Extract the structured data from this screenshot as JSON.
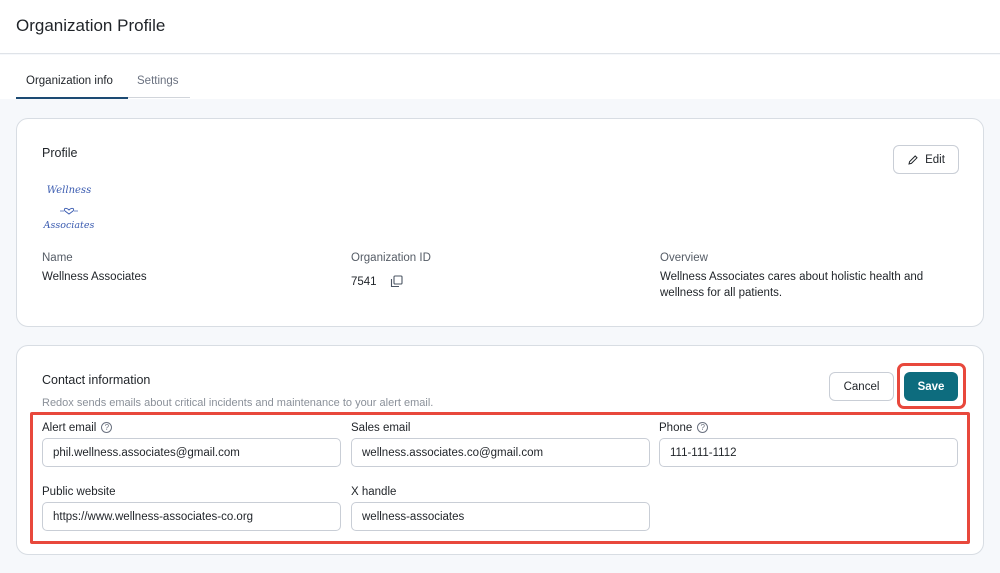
{
  "header": {
    "title": "Organization Profile"
  },
  "tabs": [
    {
      "label": "Organization info",
      "active": true
    },
    {
      "label": "Settings",
      "active": false
    }
  ],
  "profile": {
    "section_title": "Profile",
    "edit_label": "Edit",
    "logo_text": {
      "line1": "Wellness",
      "line2": "Associates"
    },
    "name_label": "Name",
    "name_value": "Wellness Associates",
    "org_id_label": "Organization ID",
    "org_id_value": "7541",
    "overview_label": "Overview",
    "overview_value": "Wellness Associates cares about holistic health and wellness for all patients."
  },
  "contact": {
    "section_title": "Contact information",
    "subtext": "Redox sends emails about critical incidents and maintenance to your alert email.",
    "cancel_label": "Cancel",
    "save_label": "Save",
    "alert_email": {
      "label": "Alert email",
      "value": "phil.wellness.associates@gmail.com"
    },
    "sales_email": {
      "label": "Sales email",
      "value": "wellness.associates.co@gmail.com"
    },
    "phone": {
      "label": "Phone",
      "value": "111-111-1112"
    },
    "public_website": {
      "label": "Public website",
      "value": "https://www.wellness-associates-co.org"
    },
    "x_handle": {
      "label": "X handle",
      "value": "wellness-associates"
    }
  },
  "colors": {
    "accent": "#0d6c7e",
    "highlight": "#e8483c",
    "tab_underline": "#1c4a73",
    "logo": "#3a5bb0"
  }
}
